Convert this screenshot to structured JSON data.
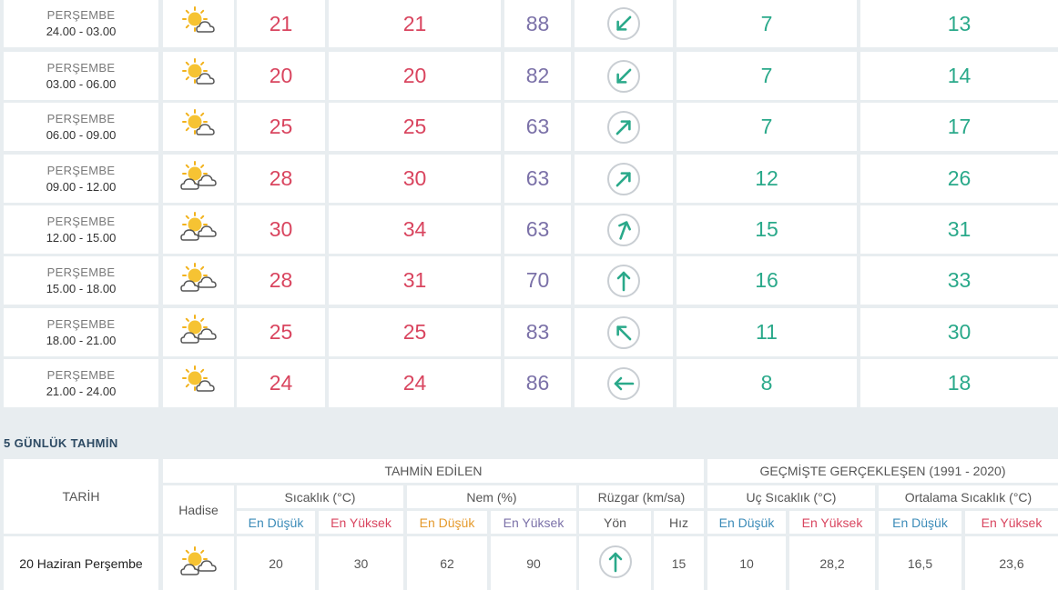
{
  "hourly_rows": [
    {
      "day": "PERŞEMBE",
      "range": "24.00 - 03.00",
      "icon": "sun-cloud-icon",
      "temp": "21",
      "feels": "21",
      "humidity": "88",
      "wind_dir_deg": 45,
      "wind_speed": "7",
      "gust": "13"
    },
    {
      "day": "PERŞEMBE",
      "range": "03.00 - 06.00",
      "icon": "sun-cloud-icon",
      "temp": "20",
      "feels": "20",
      "humidity": "82",
      "wind_dir_deg": 45,
      "wind_speed": "7",
      "gust": "14"
    },
    {
      "day": "PERŞEMBE",
      "range": "06.00 - 09.00",
      "icon": "sun-cloud-icon",
      "temp": "25",
      "feels": "25",
      "humidity": "63",
      "wind_dir_deg": 225,
      "wind_speed": "7",
      "gust": "17"
    },
    {
      "day": "PERŞEMBE",
      "range": "09.00 - 12.00",
      "icon": "sun-clouds-icon",
      "temp": "28",
      "feels": "30",
      "humidity": "63",
      "wind_dir_deg": 225,
      "wind_speed": "12",
      "gust": "26"
    },
    {
      "day": "PERŞEMBE",
      "range": "12.00 - 15.00",
      "icon": "sun-clouds-icon",
      "temp": "30",
      "feels": "34",
      "humidity": "63",
      "wind_dir_deg": 200,
      "wind_speed": "15",
      "gust": "31"
    },
    {
      "day": "PERŞEMBE",
      "range": "15.00 - 18.00",
      "icon": "sun-clouds-icon",
      "temp": "28",
      "feels": "31",
      "humidity": "70",
      "wind_dir_deg": 180,
      "wind_speed": "16",
      "gust": "33"
    },
    {
      "day": "PERŞEMBE",
      "range": "18.00 - 21.00",
      "icon": "sun-clouds-icon",
      "temp": "25",
      "feels": "25",
      "humidity": "83",
      "wind_dir_deg": 135,
      "wind_speed": "11",
      "gust": "30"
    },
    {
      "day": "PERŞEMBE",
      "range": "21.00 - 24.00",
      "icon": "sun-cloud-icon",
      "temp": "24",
      "feels": "24",
      "humidity": "86",
      "wind_dir_deg": 90,
      "wind_speed": "8",
      "gust": "18"
    }
  ],
  "forecast": {
    "title": "5 GÜNLÜK TAHMİN",
    "headers": {
      "date": "TARİH",
      "predicted": "TAHMİN EDİLEN",
      "history": "GEÇMİŞTE GERÇEKLEŞEN (1991 - 2020)",
      "condition": "Hadise",
      "temperature": "Sıcaklık (°C)",
      "humidity": "Nem (%)",
      "wind": "Rüzgar (km/sa)",
      "extreme_temp": "Uç Sıcaklık (°C)",
      "avg_temp": "Ortalama Sıcaklık (°C)",
      "min": "En Düşük",
      "max": "En Yüksek",
      "direction": "Yön",
      "speed": "Hız"
    },
    "rows": [
      {
        "date": "20 Haziran Perşembe",
        "icon": "sun-clouds-icon",
        "temp_min": "20",
        "temp_max": "30",
        "hum_min": "62",
        "hum_max": "90",
        "wind_dir_deg": 180,
        "wind_speed": "15",
        "ext_min": "10",
        "ext_max": "28,2",
        "avg_min": "16,5",
        "avg_max": "23,6"
      }
    ]
  },
  "colors": {
    "red": "#d9455f",
    "purple": "#7b71a8",
    "green": "#2aa98a",
    "blue": "#3b8bb8",
    "orange": "#e59a2c"
  }
}
